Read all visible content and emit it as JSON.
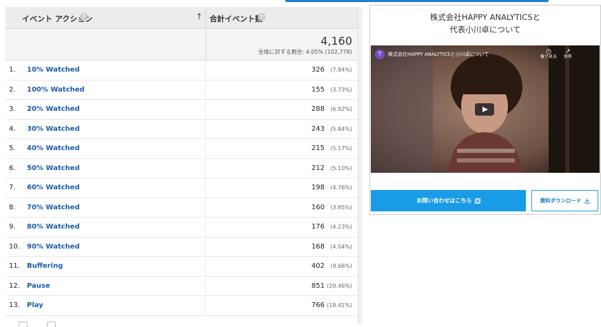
{
  "table": {
    "dimension_header": "イベント アクション",
    "metric_header": "合計イベント数",
    "help_glyph": "?",
    "sort_glyph": "↑",
    "totals": {
      "value": "4,160",
      "percent_text": "全体に対する割合: 4.05% (102,778)"
    },
    "rows": [
      {
        "index": "1.",
        "name": "10% Watched",
        "value": "326",
        "percent": "(7.84%)"
      },
      {
        "index": "2.",
        "name": "100% Watched",
        "value": "155",
        "percent": "(3.73%)"
      },
      {
        "index": "3.",
        "name": "20% Watched",
        "value": "288",
        "percent": "(6.92%)"
      },
      {
        "index": "4.",
        "name": "30% Watched",
        "value": "243",
        "percent": "(5.84%)"
      },
      {
        "index": "5.",
        "name": "40% Watched",
        "value": "215",
        "percent": "(5.17%)"
      },
      {
        "index": "6.",
        "name": "50% Watched",
        "value": "212",
        "percent": "(5.10%)"
      },
      {
        "index": "7.",
        "name": "60% Watched",
        "value": "198",
        "percent": "(4.76%)"
      },
      {
        "index": "8.",
        "name": "70% Watched",
        "value": "160",
        "percent": "(3.85%)"
      },
      {
        "index": "9.",
        "name": "80% Watched",
        "value": "176",
        "percent": "(4.23%)"
      },
      {
        "index": "10.",
        "name": "90% Watched",
        "value": "168",
        "percent": "(4.04%)"
      },
      {
        "index": "11.",
        "name": "Buffering",
        "value": "402",
        "percent": "(9.66%)"
      },
      {
        "index": "12.",
        "name": "Pause",
        "value": "851",
        "percent": "(20.46%)"
      },
      {
        "index": "13.",
        "name": "Play",
        "value": "766",
        "percent": "(18.41%)"
      }
    ]
  },
  "promo": {
    "title_line1": "株式会社HAPPY ANALYTICSと",
    "title_line2": "代表小川卓について",
    "video": {
      "channel_initial": "T",
      "title": "株式会社HAPPY ANALYTICSと小川卓について",
      "watch_later_label": "後で見る",
      "share_label": "共有"
    },
    "contact_label": "お問い合わせはこちら",
    "download_label": "資料ダウンロード"
  },
  "colors": {
    "link": "#1a5da8",
    "accent": "#1a9be6",
    "header_bg": "#ececec"
  }
}
